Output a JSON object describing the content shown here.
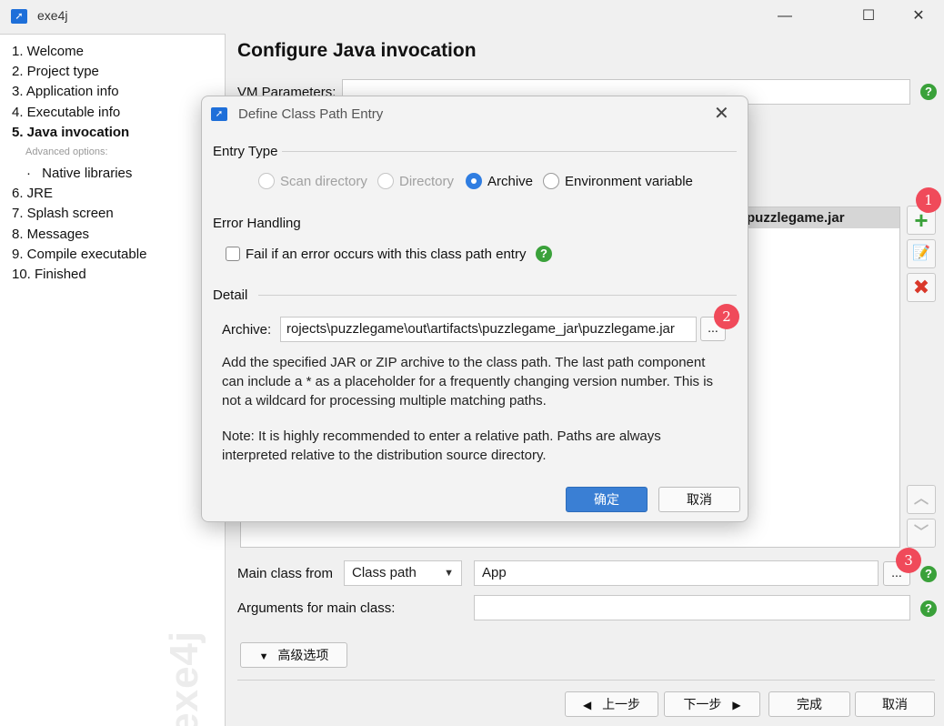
{
  "window": {
    "title": "exe4j",
    "minimize": "—",
    "maximize": "☐",
    "close": "✕"
  },
  "nav": {
    "items": [
      {
        "label": "1. Welcome"
      },
      {
        "label": "2. Project type"
      },
      {
        "label": "3. Application info"
      },
      {
        "label": "4. Executable info"
      },
      {
        "label": "5. Java invocation"
      },
      {
        "label": "6. JRE"
      },
      {
        "label": "7. Splash screen"
      },
      {
        "label": "8. Messages"
      },
      {
        "label": "9. Compile executable"
      },
      {
        "label": "10. Finished"
      }
    ],
    "advanced_header": "Advanced options:",
    "native_libraries": "Native libraries",
    "watermark": "exe4j"
  },
  "main": {
    "title": "Configure Java invocation",
    "vm_parameters_label": "VM Parameters:",
    "classpath_entry": "puzzlegame.jar",
    "main_class_from_label": "Main class from",
    "main_class_source": "Class path",
    "main_class_value": "App",
    "arguments_label": "Arguments for main class:",
    "advanced_button": "高级选项",
    "ellipsis": "...",
    "help": "?"
  },
  "badges": {
    "one": "1",
    "two": "2",
    "three": "3"
  },
  "footer": {
    "back": "上一步",
    "next": "下一步",
    "finish": "完成",
    "cancel": "取消"
  },
  "dialog": {
    "title": "Define Class Path Entry",
    "entry_type_label": "Entry Type",
    "entry_types": [
      {
        "label": "Scan directory",
        "state": "disabled"
      },
      {
        "label": "Directory",
        "state": "disabled"
      },
      {
        "label": "Archive",
        "state": "checked"
      },
      {
        "label": "Environment variable",
        "state": "unchecked"
      }
    ],
    "error_handling_label": "Error Handling",
    "fail_checkbox_label": "Fail if an error occurs with this class path entry",
    "detail_label": "Detail",
    "archive_label": "Archive:",
    "archive_value": "rojects\\puzzlegame\\out\\artifacts\\puzzlegame_jar\\puzzlegame.jar",
    "description_lines": [
      "Add the specified JAR or ZIP archive to the class path. The last path component",
      "can include a * as a placeholder for a frequently changing version number. This is",
      "not a wildcard for processing multiple matching paths."
    ],
    "note_lines": [
      "Note: It is highly recommended to enter a relative path. Paths are always",
      "interpreted relative to the distribution source directory."
    ],
    "ok": "确定",
    "cancel": "取消"
  },
  "colors": {
    "accent": "#3a7fd4",
    "badge": "#f04a5a",
    "help": "#3aa13a"
  }
}
